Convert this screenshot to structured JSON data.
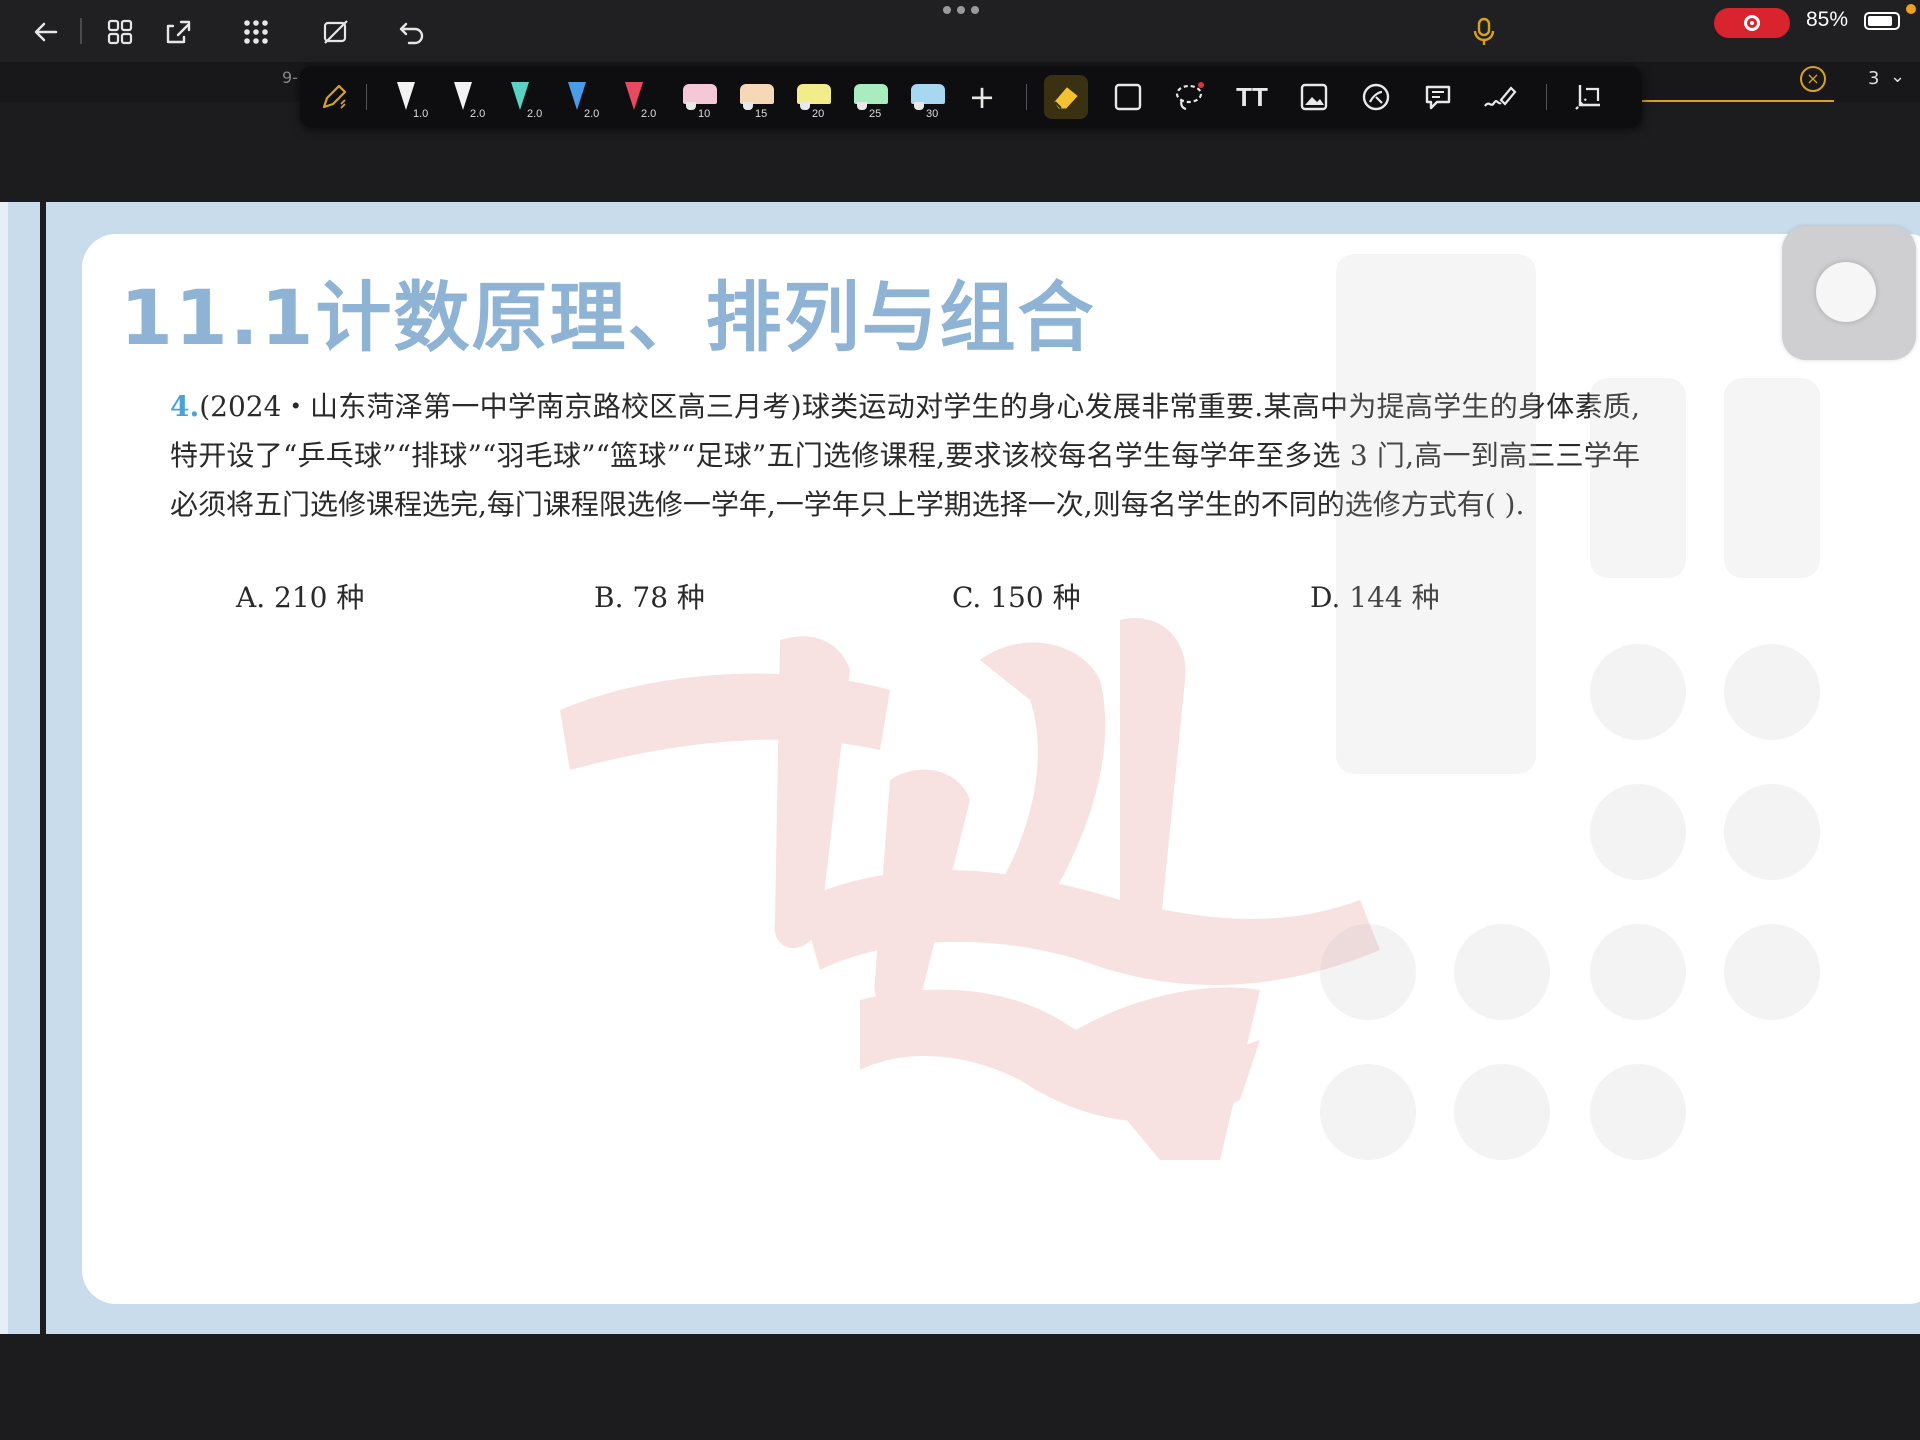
{
  "tab": {
    "label": "9-",
    "page_number": "3"
  },
  "status": {
    "battery": "85%"
  },
  "toolbar": {
    "pens": [
      {
        "size": "1.0",
        "color": "#f2f2f2",
        "kind": "pen"
      },
      {
        "size": "2.0",
        "color": "#f2f2f2",
        "kind": "pen"
      },
      {
        "size": "2.0",
        "color": "#5ad1c2",
        "kind": "pen"
      },
      {
        "size": "2.0",
        "color": "#4a9be8",
        "kind": "pen"
      },
      {
        "size": "2.0",
        "color": "#e84a5f",
        "kind": "pen"
      },
      {
        "size": "10",
        "color": "#f4c8d6",
        "kind": "highlighter"
      },
      {
        "size": "15",
        "color": "#f6d7b8",
        "kind": "highlighter"
      },
      {
        "size": "20",
        "color": "#f3ec8a",
        "kind": "highlighter"
      },
      {
        "size": "25",
        "color": "#a8ecc0",
        "kind": "highlighter"
      },
      {
        "size": "30",
        "color": "#a8d8f0",
        "kind": "highlighter"
      }
    ],
    "add_label": "+",
    "text_tool_label": "TT"
  },
  "document": {
    "title": "11.1计数原理、排列与组合",
    "question": {
      "number": "4.",
      "text": "(2024・山东菏泽第一中学南京路校区高三月考)球类运动对学生的身心发展非常重要.某高中为提高学生的身体素质,特开设了“乒乓球”“排球”“羽毛球”“篮球”“足球”五门选修课程,要求该校每名学生每学年至多选 3 门,高一到高三三学年必须将五门选修课程选完,每门课程限选修一学年,一学年只上学期选择一次,则每名学生的不同的选修方式有(        )."
    },
    "options": [
      {
        "letter": "A.",
        "text": "210 种"
      },
      {
        "letter": "B.",
        "text": "78 种"
      },
      {
        "letter": "C.",
        "text": "150 种"
      },
      {
        "letter": "D.",
        "text": "144 种"
      }
    ]
  },
  "icons": [
    "back-arrow-icon",
    "grid-icon",
    "share-icon",
    "apps-icon",
    "no-edit-icon",
    "undo-icon",
    "mic-icon",
    "record-icon",
    "battery-icon",
    "close-circle-icon",
    "chevron-down-icon",
    "pencil-bluetooth-icon",
    "eraser-icon",
    "rectangle-icon",
    "lasso-icon",
    "text-icon",
    "image-icon",
    "sticker-icon",
    "comment-icon",
    "signature-icon",
    "crop-icon"
  ]
}
